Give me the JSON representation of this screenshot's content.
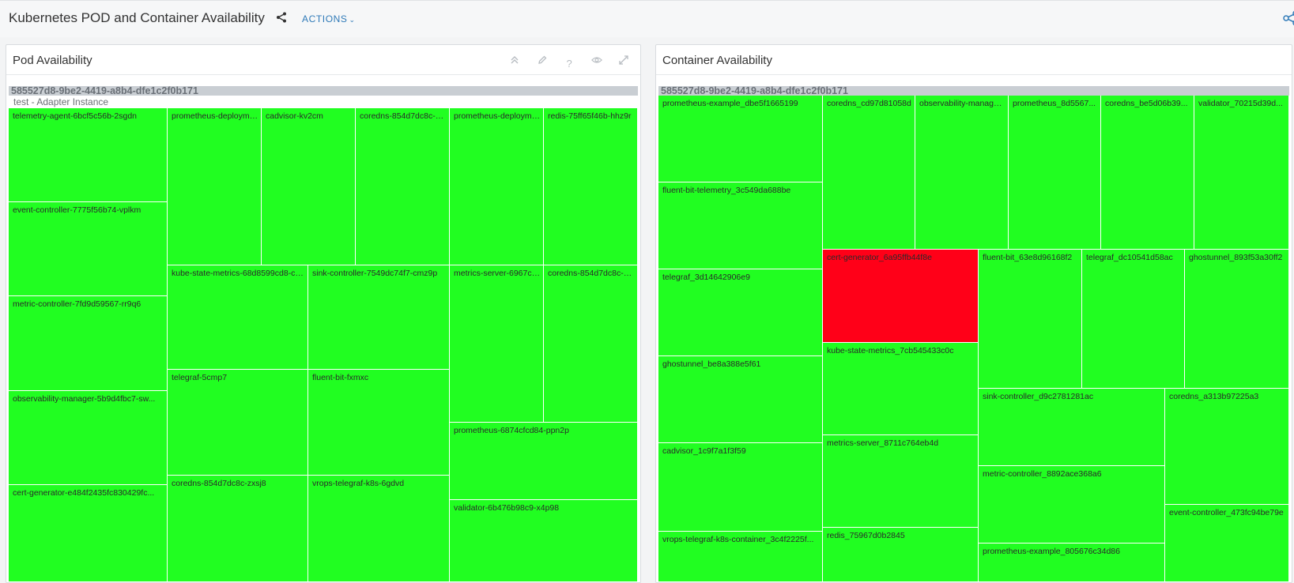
{
  "header": {
    "title": "Kubernetes POD and Container Availability",
    "actions_label": "ACTIONS"
  },
  "colors": {
    "available": "#21fe21",
    "unavailable": "#ff0018",
    "link": "#2f7ab8"
  },
  "icons": [
    "share-icon",
    "chevron-down-icon",
    "collapse-icon",
    "edit-icon",
    "help-icon",
    "view-icon",
    "expand-icon"
  ],
  "pod_panel": {
    "title": "Pod Availability",
    "group_name": "585527d8-9be2-4419-a8b4-dfe1c2f0b171",
    "adapter_label": "test - Adapter Instance",
    "cells": [
      {
        "label": "telemetry-agent-6bcf5c56b-2sgdn",
        "status": "available"
      },
      {
        "label": "event-controller-7775f56b74-vplkm",
        "status": "available"
      },
      {
        "label": "metric-controller-7fd9d59567-rr9q6",
        "status": "available"
      },
      {
        "label": "observability-manager-5b9d4fbc7-sw...",
        "status": "available"
      },
      {
        "label": "cert-generator-e484f2435fc830429fc...",
        "status": "available"
      },
      {
        "label": "prometheus-deployme...",
        "status": "available"
      },
      {
        "label": "cadvisor-kv2cm",
        "status": "available"
      },
      {
        "label": "coredns-854d7dc8c-kn...",
        "status": "available"
      },
      {
        "label": "kube-state-metrics-68d8599cd8-cn...",
        "status": "available"
      },
      {
        "label": "sink-controller-7549dc74f7-cmz9p",
        "status": "available"
      },
      {
        "label": "telegraf-5cmp7",
        "status": "available"
      },
      {
        "label": "fluent-bit-fxmxc",
        "status": "available"
      },
      {
        "label": "coredns-854d7dc8c-zxsj8",
        "status": "available"
      },
      {
        "label": "vrops-telegraf-k8s-6gdvd",
        "status": "available"
      },
      {
        "label": "prometheus-deployme...",
        "status": "available"
      },
      {
        "label": "redis-75ff65f46b-hhz9r",
        "status": "available"
      },
      {
        "label": "metrics-server-6967cb...",
        "status": "available"
      },
      {
        "label": "coredns-854d7dc8c-sd...",
        "status": "available"
      },
      {
        "label": "prometheus-6874cfcd84-ppn2p",
        "status": "available"
      },
      {
        "label": "validator-6b476b98c9-x4p98",
        "status": "available"
      }
    ]
  },
  "container_panel": {
    "title": "Container Availability",
    "group_name": "585527d8-9be2-4419-a8b4-dfe1c2f0b171",
    "cells": [
      {
        "label": "prometheus-example_dbe5f1665199",
        "status": "available"
      },
      {
        "label": "fluent-bit-telemetry_3c549da688be",
        "status": "available"
      },
      {
        "label": "telegraf_3d14642906e9",
        "status": "available"
      },
      {
        "label": "ghostunnel_be8a388e5f61",
        "status": "available"
      },
      {
        "label": "cadvisor_1c9f7a1f3f59",
        "status": "available"
      },
      {
        "label": "vrops-telegraf-k8s-container_3c4f2225f...",
        "status": "available"
      },
      {
        "label": "coredns_cd97d81058d",
        "status": "available"
      },
      {
        "label": "observability-manager...",
        "status": "available"
      },
      {
        "label": "prometheus_8d5567...",
        "status": "available"
      },
      {
        "label": "coredns_be5d06b39...",
        "status": "available"
      },
      {
        "label": "validator_70215d39d...",
        "status": "available"
      },
      {
        "label": "cert-generator_6a95ffb44f8e",
        "status": "unavailable"
      },
      {
        "label": "kube-state-metrics_7cb545433c0c",
        "status": "available"
      },
      {
        "label": "metrics-server_8711c764eb4d",
        "status": "available"
      },
      {
        "label": "redis_75967d0b2845",
        "status": "available"
      },
      {
        "label": "fluent-bit_63e8d96168f2",
        "status": "available"
      },
      {
        "label": "telegraf_dc10541d58ac",
        "status": "available"
      },
      {
        "label": "ghostunnel_893f53a30ff2",
        "status": "available"
      },
      {
        "label": "sink-controller_d9c2781281ac",
        "status": "available"
      },
      {
        "label": "coredns_a313b97225a3",
        "status": "available"
      },
      {
        "label": "metric-controller_8892ace368a6",
        "status": "available"
      },
      {
        "label": "event-controller_473fc94be79e",
        "status": "available"
      },
      {
        "label": "prometheus-example_805676c34d86",
        "status": "available"
      }
    ]
  }
}
